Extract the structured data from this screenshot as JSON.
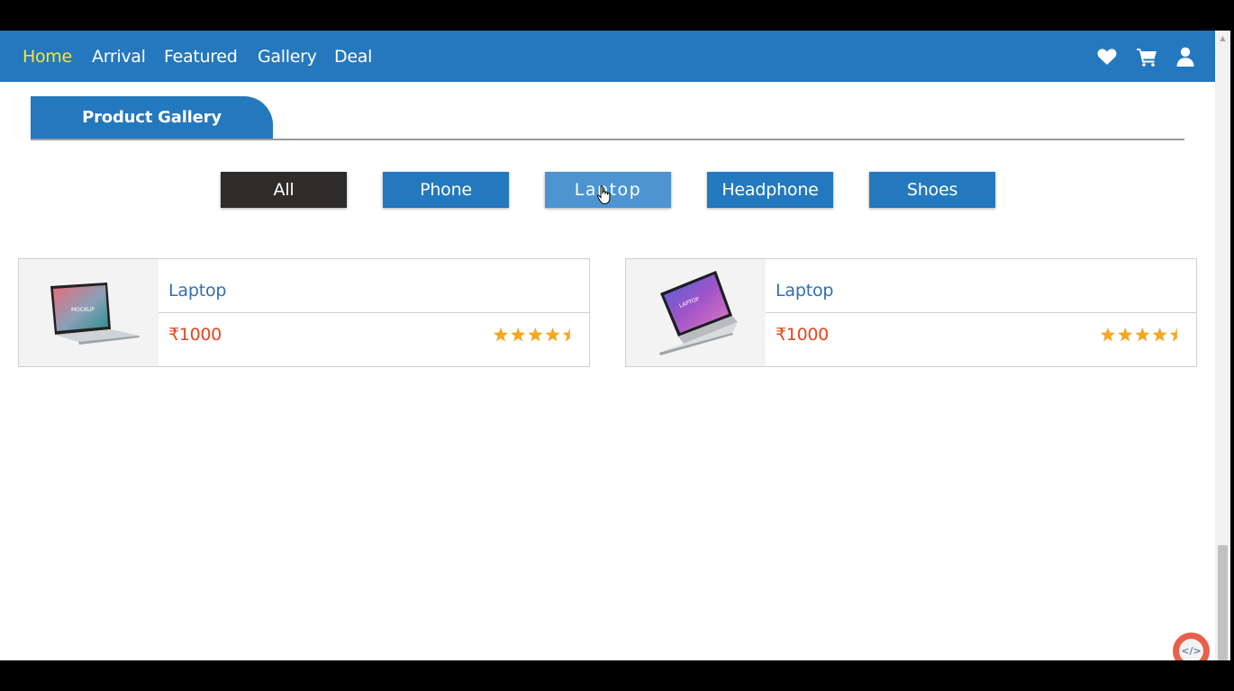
{
  "nav": {
    "links": [
      "Home",
      "Arrival",
      "Featured",
      "Gallery",
      "Deal"
    ],
    "active": "Home",
    "icons": [
      "heart-icon",
      "cart-icon",
      "user-icon"
    ]
  },
  "gallery": {
    "title": "Product Gallery",
    "filters": [
      "All",
      "Phone",
      "Laptop",
      "Headphone",
      "Shoes"
    ],
    "active_filter": "All",
    "hovered_filter": "Laptop"
  },
  "products": [
    {
      "name": "Laptop",
      "price": "₹1000",
      "rating": 4.5,
      "image": "laptop-mockup-image"
    },
    {
      "name": "Laptop",
      "price": "₹1000",
      "rating": 4.5,
      "image": "laptop-mockup-image"
    }
  ],
  "colors": {
    "primary": "#2478be",
    "active_nav": "#f5e63d",
    "active_filter": "#2f2d2c",
    "price": "#e4471c",
    "product_name": "#2e6fb0",
    "star": "#f5a623"
  },
  "fab": {
    "label": "</>",
    "icon": "code-icon"
  }
}
